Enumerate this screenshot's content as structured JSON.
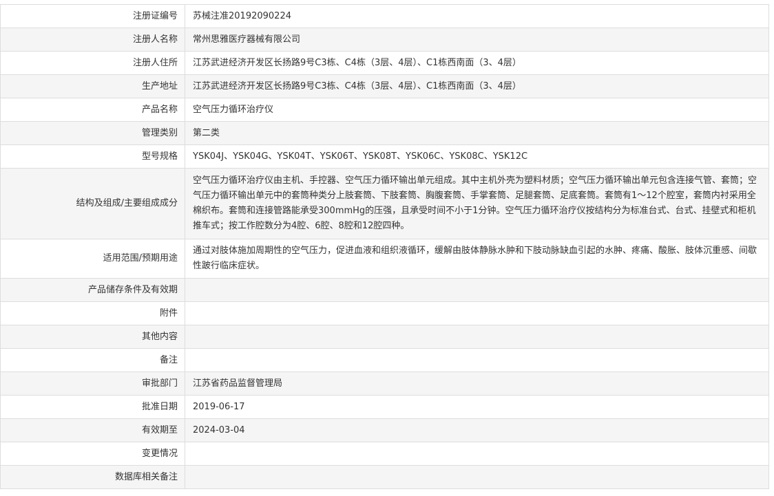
{
  "rows": [
    {
      "label": "注册证编号",
      "value": "苏械注准20192090224"
    },
    {
      "label": "注册人名称",
      "value": "常州思雅医疗器械有限公司"
    },
    {
      "label": "注册人住所",
      "value": "江苏武进经济开发区长扬路9号C3栋、C4栋（3层、4层）、C1栋西南面（3、4层）"
    },
    {
      "label": "生产地址",
      "value": "江苏武进经济开发区长扬路9号C3栋、C4栋（3层、4层）、C1栋西南面（3、4层）"
    },
    {
      "label": "产品名称",
      "value": "空气压力循环治疗仪"
    },
    {
      "label": "管理类别",
      "value": "第二类"
    },
    {
      "label": "型号规格",
      "value": "YSK04J、YSK04G、YSK04T、YSK06T、YSK08T、YSK06C、YSK08C、YSK12C"
    },
    {
      "label": "结构及组成/主要组成成分",
      "value": "空气压力循环治疗仪由主机、手控器、空气压力循环输出单元组成。其中主机外壳为塑料材质；空气压力循环输出单元包含连接气管、套筒；空气压力循环输出单元中的套筒种类分上肢套筒、下肢套筒、胸腹套筒、手掌套筒、足腿套筒、足底套筒。套筒有1～12个腔室，套筒内衬采用全棉织布。套筒和连接管路能承受300mmHg的压强，且承受时间不小于1分钟。空气压力循环治疗仪按结构分为标准台式、台式、挂壁式和柜机推车式；按工作腔数分为4腔、6腔、8腔和12腔四种。"
    },
    {
      "label": "适用范围/预期用途",
      "value": "通过对肢体施加周期性的空气压力，促进血液和组织液循环，缓解由肢体静脉水肿和下肢动脉缺血引起的水肿、疼痛、酸胀、肢体沉重感、间歇性跛行临床症状。"
    },
    {
      "label": "产品储存条件及有效期",
      "value": ""
    },
    {
      "label": "附件",
      "value": ""
    },
    {
      "label": "其他内容",
      "value": ""
    },
    {
      "label": "备注",
      "value": ""
    },
    {
      "label": "审批部门",
      "value": "江苏省药品监督管理局"
    },
    {
      "label": "批准日期",
      "value": "2019-06-17"
    },
    {
      "label": "有效期至",
      "value": "2024-03-04"
    },
    {
      "label": "变更情况",
      "value": ""
    },
    {
      "label": "数据库相关备注",
      "value": ""
    }
  ]
}
